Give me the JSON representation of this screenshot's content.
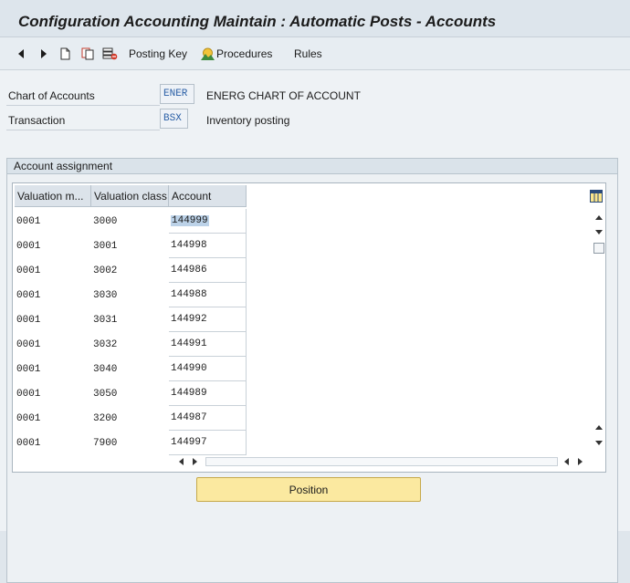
{
  "window": {
    "title": "Configuration Accounting Maintain : Automatic Posts - Accounts"
  },
  "toolbar": {
    "icons": [
      "arrow-left-icon",
      "arrow-right-icon",
      "new-document-icon",
      "copy-icon",
      "delete-icon",
      "procedures-icon",
      "layout-settings-icon"
    ],
    "posting_key_label": "Posting Key",
    "procedures_label": "Procedures",
    "rules_label": "Rules"
  },
  "fields": {
    "chart_of_accounts": {
      "label": "Chart of Accounts",
      "value": "ENER",
      "description": "ENERG CHART OF ACCOUNT"
    },
    "transaction": {
      "label": "Transaction",
      "value": "BSX",
      "description": "Inventory posting"
    }
  },
  "group": {
    "title": "Account assignment"
  },
  "table": {
    "columns": [
      "Valuation m...",
      "Valuation class",
      "Account"
    ],
    "rows": [
      {
        "valuation_modif": "0001",
        "valuation_class": "3000",
        "account": "144999",
        "selected": true
      },
      {
        "valuation_modif": "0001",
        "valuation_class": "3001",
        "account": "144998"
      },
      {
        "valuation_modif": "0001",
        "valuation_class": "3002",
        "account": "144986"
      },
      {
        "valuation_modif": "0001",
        "valuation_class": "3030",
        "account": "144988"
      },
      {
        "valuation_modif": "0001",
        "valuation_class": "3031",
        "account": "144992"
      },
      {
        "valuation_modif": "0001",
        "valuation_class": "3032",
        "account": "144991"
      },
      {
        "valuation_modif": "0001",
        "valuation_class": "3040",
        "account": "144990"
      },
      {
        "valuation_modif": "0001",
        "valuation_class": "3050",
        "account": "144989"
      },
      {
        "valuation_modif": "0001",
        "valuation_class": "3200",
        "account": "144987"
      },
      {
        "valuation_modif": "0001",
        "valuation_class": "7900",
        "account": "144997"
      }
    ]
  },
  "position_button": {
    "label": "Position"
  },
  "colors": {
    "accent_button": "#fbe9a0",
    "selection": "#bcd2e8",
    "input_text": "#2a5fa6"
  }
}
